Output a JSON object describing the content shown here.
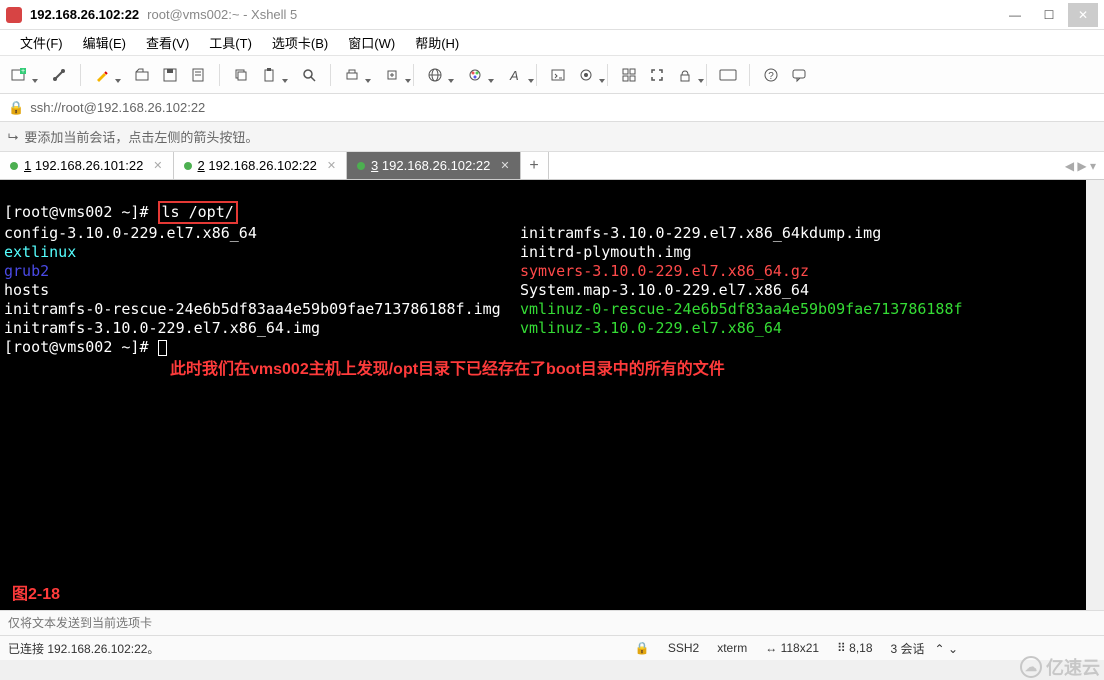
{
  "titlebar": {
    "title_main": "192.168.26.102:22",
    "title_sub": "root@vms002:~ - Xshell 5"
  },
  "menu": {
    "file": "文件(F)",
    "edit": "编辑(E)",
    "view": "查看(V)",
    "tools": "工具(T)",
    "tabs": "选项卡(B)",
    "window": "窗口(W)",
    "help": "帮助(H)"
  },
  "addressbar": {
    "url": "ssh://root@192.168.26.102:22"
  },
  "infobar": {
    "hint": "要添加当前会话，点击左侧的箭头按钮。"
  },
  "tabs": [
    {
      "num": "1",
      "label": "192.168.26.101:22"
    },
    {
      "num": "2",
      "label": "192.168.26.102:22"
    },
    {
      "num": "3",
      "label": "192.168.26.102:22"
    }
  ],
  "terminal": {
    "prompt1": "[root@vms002 ~]#",
    "command": "ls /opt/",
    "row1_l": "config-3.10.0-229.el7.x86_64",
    "row1_r": "initramfs-3.10.0-229.el7.x86_64kdump.img",
    "row2_l": "extlinux",
    "row2_r": "initrd-plymouth.img",
    "row3_l": "grub2",
    "row3_r": "symvers-3.10.0-229.el7.x86_64.gz",
    "row4_l": "hosts",
    "row4_r": "System.map-3.10.0-229.el7.x86_64",
    "row5_l": "initramfs-0-rescue-24e6b5df83aa4e59b09fae713786188f.img",
    "row5_r": "vmlinuz-0-rescue-24e6b5df83aa4e59b09fae713786188f",
    "row6_l": "initramfs-3.10.0-229.el7.x86_64.img",
    "row6_r": "vmlinuz-3.10.0-229.el7.x86_64",
    "prompt2": "[root@vms002 ~]# ",
    "annotation": "此时我们在vms002主机上发现/opt目录下已经存在了boot目录中的所有的文件",
    "figure_label": "图2-18"
  },
  "sendbar": {
    "placeholder": "仅将文本发送到当前选项卡"
  },
  "statusbar": {
    "conn": "已连接 192.168.26.102:22。",
    "ssh": "SSH2",
    "term": "xterm",
    "size": "118x21",
    "cursor": "8,18",
    "sessions": "3 会话"
  },
  "watermark": {
    "text": "亿速云"
  }
}
